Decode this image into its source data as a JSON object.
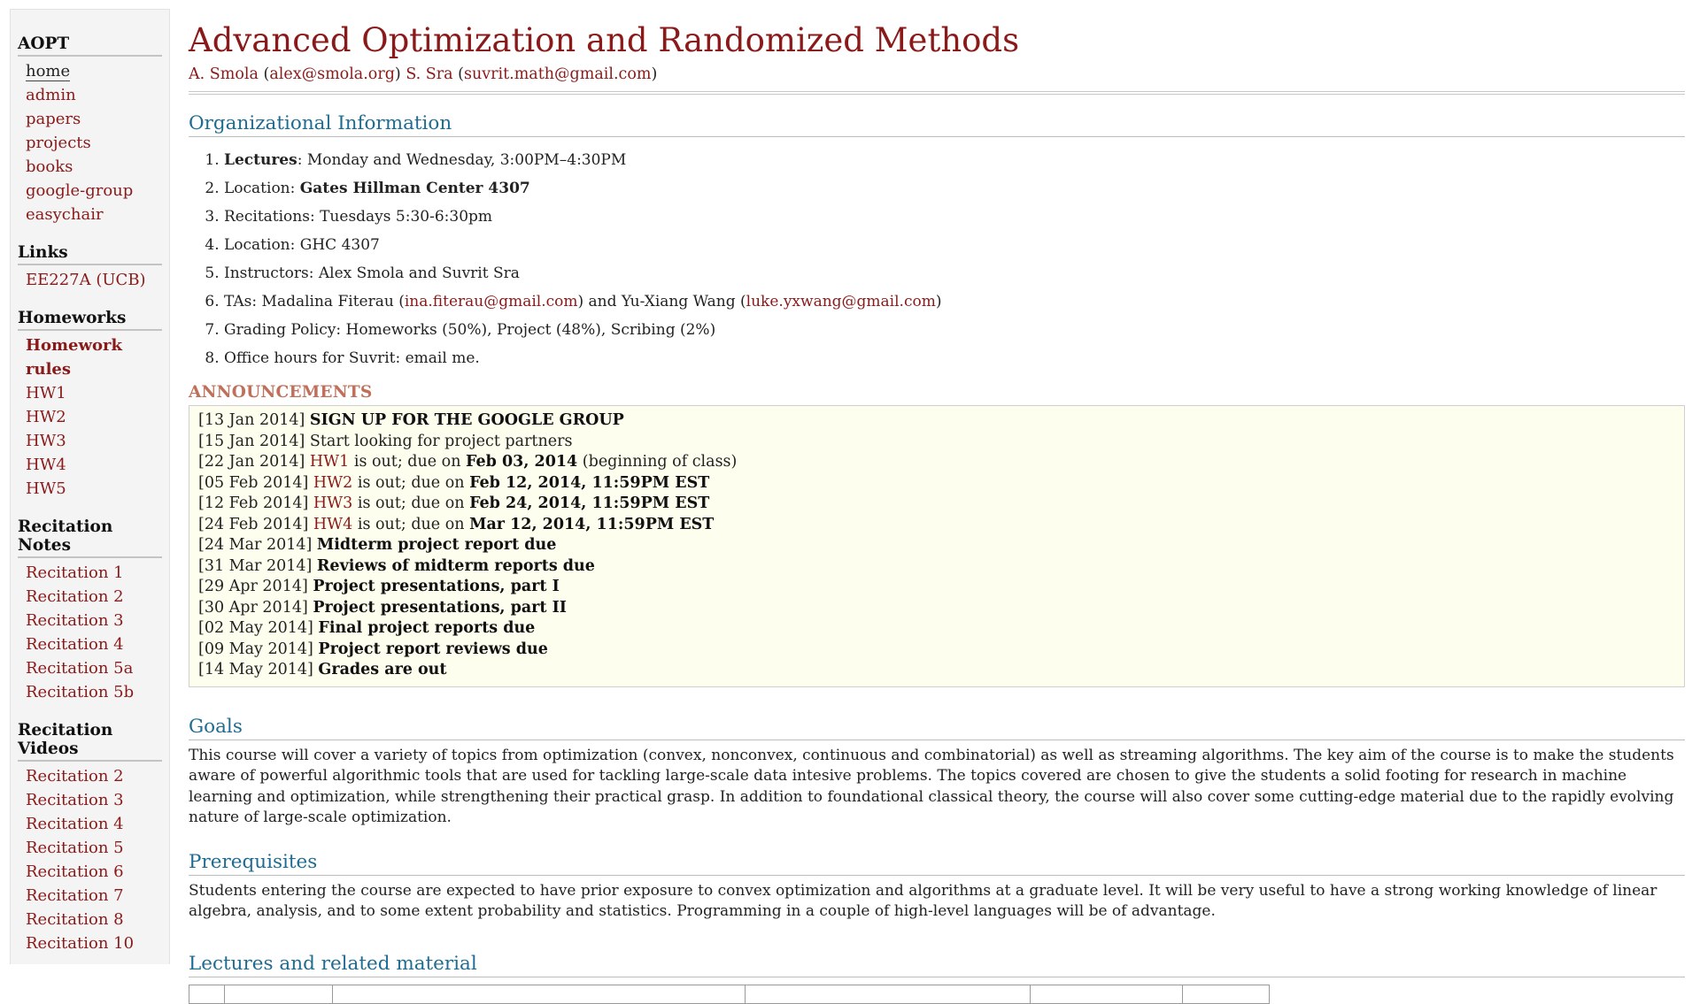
{
  "sidebar": {
    "groups": [
      {
        "heading": "AOPT",
        "items": [
          {
            "label": "home",
            "current": true
          },
          {
            "label": "admin"
          },
          {
            "label": "papers"
          },
          {
            "label": "projects"
          },
          {
            "label": "books"
          },
          {
            "label": "google-group"
          },
          {
            "label": "easychair"
          }
        ]
      },
      {
        "heading": "Links",
        "items": [
          {
            "label": "EE227A (UCB)"
          }
        ]
      },
      {
        "heading": "Homeworks",
        "items": [
          {
            "label": "Homework rules",
            "bold": true
          },
          {
            "label": "HW1"
          },
          {
            "label": "HW2"
          },
          {
            "label": "HW3"
          },
          {
            "label": "HW4"
          },
          {
            "label": "HW5"
          }
        ]
      },
      {
        "heading": "Recitation Notes",
        "items": [
          {
            "label": "Recitation 1"
          },
          {
            "label": "Recitation 2"
          },
          {
            "label": "Recitation 3"
          },
          {
            "label": "Recitation 4"
          },
          {
            "label": "Recitation 5a"
          },
          {
            "label": "Recitation 5b"
          }
        ]
      },
      {
        "heading": "Recitation Videos",
        "items": [
          {
            "label": "Recitation 2"
          },
          {
            "label": "Recitation 3"
          },
          {
            "label": "Recitation 4"
          },
          {
            "label": "Recitation 5"
          },
          {
            "label": "Recitation 6"
          },
          {
            "label": "Recitation 7"
          },
          {
            "label": "Recitation 8"
          },
          {
            "label": "Recitation 10"
          }
        ]
      }
    ]
  },
  "header": {
    "title": "Advanced Optimization and Randomized Methods",
    "author1": "A. Smola",
    "author1_email": "alex@smola.org",
    "author2": "S. Sra",
    "author2_email": "suvrit.math@gmail.com"
  },
  "org": {
    "heading": "Organizational Information",
    "items": [
      {
        "bold": "Lectures",
        "text": ": Monday and Wednesday, 3:00PM–4:30PM"
      },
      {
        "text": "Location: ",
        "bold_after": "Gates Hillman Center 4307"
      },
      {
        "text": "Recitations: Tuesdays 5:30-6:30pm"
      },
      {
        "text": "Location: GHC 4307"
      },
      {
        "text": "Instructors: Alex Smola and Suvrit Sra"
      },
      {
        "ta": true,
        "prefix": "TAs: Madalina Fiterau (",
        "link1": "ina.fiterau@gmail.com",
        "middle": ") and Yu-Xiang Wang (",
        "link2": "luke.yxwang@gmail.com",
        "suffix": ")"
      },
      {
        "text": "Grading Policy: Homeworks (50%), Project (48%), Scribing (2%)"
      },
      {
        "text": "Office hours for Suvrit: email me."
      }
    ]
  },
  "announcements": {
    "heading": "ANNOUNCEMENTS",
    "items": [
      {
        "date": "[13 Jan 2014]",
        "bold": "SIGN UP FOR THE GOOGLE GROUP"
      },
      {
        "date": "[15 Jan 2014]",
        "text": "Start looking for project partners"
      },
      {
        "date": "[22 Jan 2014]",
        "link": "HW1",
        "text": " is out; due on ",
        "bold": "Feb 03, 2014",
        "after": " (beginning of class)"
      },
      {
        "date": "[05 Feb 2014]",
        "link": "HW2",
        "text": " is out; due on ",
        "bold": "Feb 12, 2014, 11:59PM EST"
      },
      {
        "date": "[12 Feb 2014]",
        "link": "HW3",
        "text": " is out; due on ",
        "bold": "Feb 24, 2014, 11:59PM EST"
      },
      {
        "date": "[24 Feb 2014]",
        "link": "HW4",
        "text": " is out; due on ",
        "bold": "Mar 12, 2014, 11:59PM EST"
      },
      {
        "date": "[24 Mar 2014]",
        "bold": "Midterm project report due"
      },
      {
        "date": "[31 Mar 2014]",
        "bold": "Reviews of midterm reports due"
      },
      {
        "date": "[29 Apr 2014]",
        "bold": "Project presentations, part I"
      },
      {
        "date": "[30 Apr 2014]",
        "bold": "Project presentations, part II"
      },
      {
        "date": "[02 May 2014]",
        "bold": "Final project reports due"
      },
      {
        "date": "[09 May 2014]",
        "bold": "Project report reviews due"
      },
      {
        "date": "[14 May 2014]",
        "bold": "Grades are out"
      }
    ]
  },
  "goals": {
    "heading": "Goals",
    "text": "This course will cover a variety of topics from optimization (convex, nonconvex, continuous and combinatorial) as well as streaming algorithms. The key aim of the course is to make the students aware of powerful algorithmic tools that are used for tackling large-scale data intesive problems. The topics covered are chosen to give the students a solid footing for research in machine learning and optimization, while strengthening their practical grasp. In addition to foundational classical theory, the course will also cover some cutting-edge material due to the rapidly evolving nature of large-scale optimization."
  },
  "prereq": {
    "heading": "Prerequisites",
    "text": "Students entering the course are expected to have prior exposure to convex optimization and algorithms at a graduate level. It will be very useful to have a strong working knowledge of linear algebra, analysis, and to some extent probability and statistics. Programming in a couple of high-level languages will be of advantage."
  },
  "lectures": {
    "heading": "Lectures and related material"
  }
}
